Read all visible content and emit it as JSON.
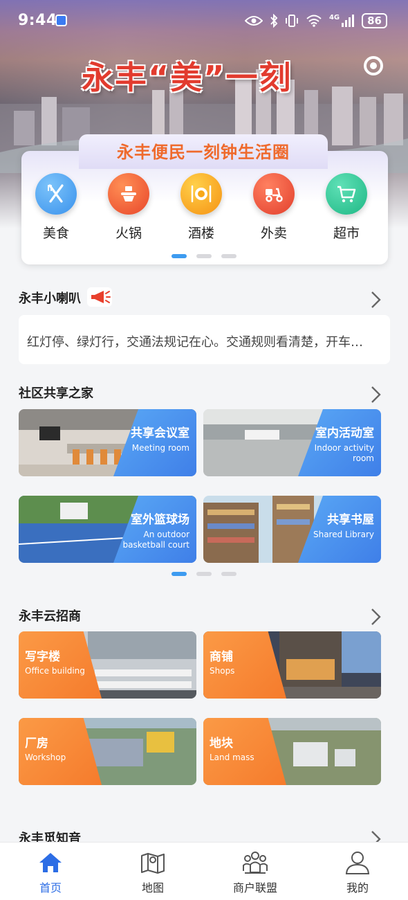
{
  "status_bar": {
    "time": "9:44",
    "battery": "86",
    "network": "4G"
  },
  "hero": {
    "title": "永丰“美”一刻"
  },
  "quick_panel": {
    "title": "永丰便民一刻钟生活圈",
    "items": [
      {
        "label": "美食",
        "icon": "utensils-icon",
        "color": "#4ca6f3"
      },
      {
        "label": "火锅",
        "icon": "hotpot-icon",
        "color": "#f3662f"
      },
      {
        "label": "酒楼",
        "icon": "dish-icon",
        "color": "#f8a818"
      },
      {
        "label": "外卖",
        "icon": "scooter-icon",
        "color": "#f0553a"
      },
      {
        "label": "超市",
        "icon": "cart-icon",
        "color": "#33c99a"
      }
    ]
  },
  "announcement": {
    "title": "永丰小喇叭",
    "text": "红灯停、绿灯行，交通法规记在心。交通规则看清楚，开车…"
  },
  "community": {
    "title": "社区共享之家",
    "cards": [
      {
        "title": "共享会议室",
        "subtitle": "Meeting room"
      },
      {
        "title": "室内活动室",
        "subtitle_line1": "Indoor activity",
        "subtitle_line2": "room"
      },
      {
        "title": "室外篮球场",
        "subtitle_line1": "An outdoor",
        "subtitle_line2": "basketball court"
      },
      {
        "title": "共享书屋",
        "subtitle": "Shared Library"
      }
    ]
  },
  "investment": {
    "title": "永丰云招商",
    "cards": [
      {
        "title": "写字楼",
        "subtitle": "Office building"
      },
      {
        "title": "商铺",
        "subtitle": "Shops"
      },
      {
        "title": "厂房",
        "subtitle": "Workshop"
      },
      {
        "title": "地块",
        "subtitle": "Land mass"
      }
    ]
  },
  "partial_section": {
    "title": "永丰觅知音"
  },
  "bottom_nav": {
    "items": [
      {
        "label": "首页",
        "icon": "home-icon",
        "active": true
      },
      {
        "label": "地图",
        "icon": "map-icon",
        "active": false
      },
      {
        "label": "商户联盟",
        "icon": "merchant-alliance-icon",
        "active": false
      },
      {
        "label": "我的",
        "icon": "profile-icon",
        "active": false
      }
    ],
    "active_color": "#2c6de5"
  }
}
